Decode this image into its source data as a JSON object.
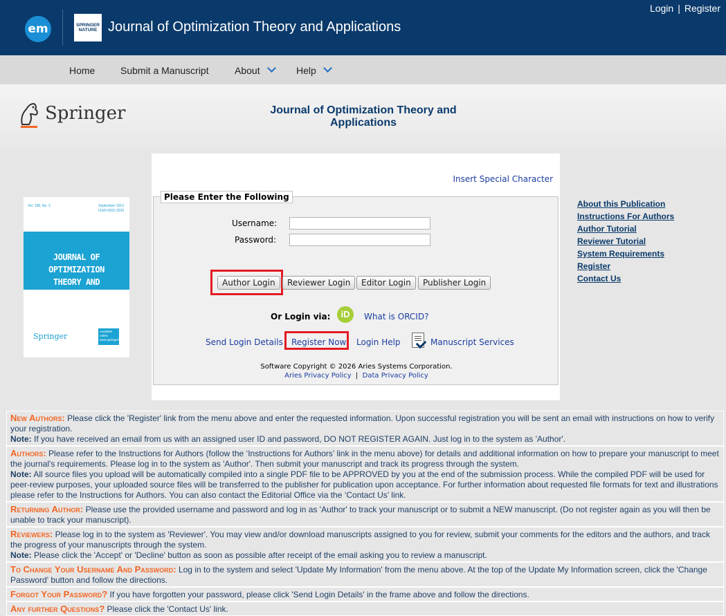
{
  "header": {
    "em_logo": "em",
    "sn_logo": "SPRINGER NATURE",
    "journal_title": "Journal of Optimization Theory and Applications",
    "login_link": "Login",
    "separator": "|",
    "register_link": "Register"
  },
  "nav": {
    "items": [
      {
        "label": "Home"
      },
      {
        "label": "Submit a Manuscript"
      },
      {
        "label": "About"
      },
      {
        "label": "Help"
      }
    ]
  },
  "band": {
    "springer_word": "Springer",
    "title_line1": "Journal of Optimization Theory and",
    "title_line2": "Applications"
  },
  "cover": {
    "top_left": "Vol. 198, No. 3",
    "top_right_1": "September 2013",
    "top_right_2": "ISSN 0022-3239",
    "top_right_3": "",
    "title_line1": "JOURNAL OF OPTIMIZATION",
    "title_line2": "THEORY AND APPLICATIONS",
    "publisher": "Springer",
    "badge": "Available online www.springerlink.com"
  },
  "login": {
    "special_char": "Insert Special Character",
    "legend": "Please Enter the Following",
    "username_label": "Username:",
    "password_label": "Password:",
    "username_value": "",
    "password_value": "",
    "buttons": {
      "author": "Author Login",
      "reviewer": "Reviewer Login",
      "editor": "Editor Login",
      "publisher": "Publisher Login"
    },
    "orcid_label": "Or Login via:",
    "orcid_icon": "iD",
    "orcid_link": "What is ORCID?",
    "send_login": "Send Login Details",
    "register_now": "Register Now",
    "login_help": "Login Help",
    "manuscript_services": "Manuscript Services",
    "copyright": "Software Copyright © 2026 Aries Systems Corporation.",
    "aries_policy": "Aries Privacy Policy",
    "policy_sep": "|",
    "data_policy": "Data Privacy Policy"
  },
  "right_links": [
    "About this Publication",
    "Instructions For Authors",
    "Author Tutorial",
    "Reviewer Tutorial",
    "System Requirements",
    "Register",
    "Contact Us"
  ],
  "info": {
    "new_authors_head": "New Authors:",
    "new_authors_text": " Please click the 'Register' link from the menu above and enter the requested information. Upon successful registration you will be sent an email with instructions on how to verify your registration.",
    "new_authors_note_label": "Note:",
    "new_authors_note": " If you have received an email from us with an assigned user ID and password, DO NOT REGISTER AGAIN. Just log in to the system as 'Author'.",
    "authors_head": "Authors:",
    "authors_text": " Please refer to the Instructions for Authors (follow the ‘Instructions for Authors’ link in the menu above) for details and additional information on how to prepare your manuscript to meet the journal's requirements. Please log in to the system as 'Author'. Then submit your manuscript and track its progress through the system.",
    "authors_note_label": "Note:",
    "authors_note": " All source files you upload will be automatically compiled into a single PDF file to be APPROVED by you at the end of the submission process. While the compiled PDF will be used for peer-review purposes, your uploaded source files will be transferred to the publisher for publication upon acceptance. For further information about requested file formats for text and illustrations please refer to the Instructions for Authors. You can also contact the Editorial Office via the ‘Contact Us’ link.",
    "returning_head": "Returning Author:",
    "returning_text": " Please use the provided username and password and log in as 'Author' to track your manuscript or to submit a NEW manuscript. (Do not register again as you will then be unable to track your manuscript).",
    "reviewers_head": "Reviewers:",
    "reviewers_text": " Please log in to the system as 'Reviewer'. You may view and/or download manuscripts assigned to you for review, submit your comments for the editors and the authors, and track the progress of your manuscripts through the system.",
    "reviewers_note_label": "Note:",
    "reviewers_note": " Please click the 'Accept' or 'Decline' button as soon as possible after receipt of the email asking you to review a manuscript.",
    "change_head": "To Change Your Username And Password:",
    "change_text": " Log in to the system and select 'Update My Information' from the menu above. At the top of the Update My Information screen, click the 'Change Password' button and follow the directions.",
    "forgot_head": "Forgot Your Password?",
    "forgot_text": " If you have forgotten your password, please click 'Send Login Details' in the frame above and follow the directions.",
    "further_head": "Any further Questions?",
    "further_text": " Please click the 'Contact Us' link."
  },
  "colors": {
    "header_bg": "#0a3a6b",
    "accent_orange": "#f26522",
    "highlight_red": "#e21b23",
    "orcid_green": "#a6ce39",
    "cover_blue": "#1ba3d3"
  }
}
